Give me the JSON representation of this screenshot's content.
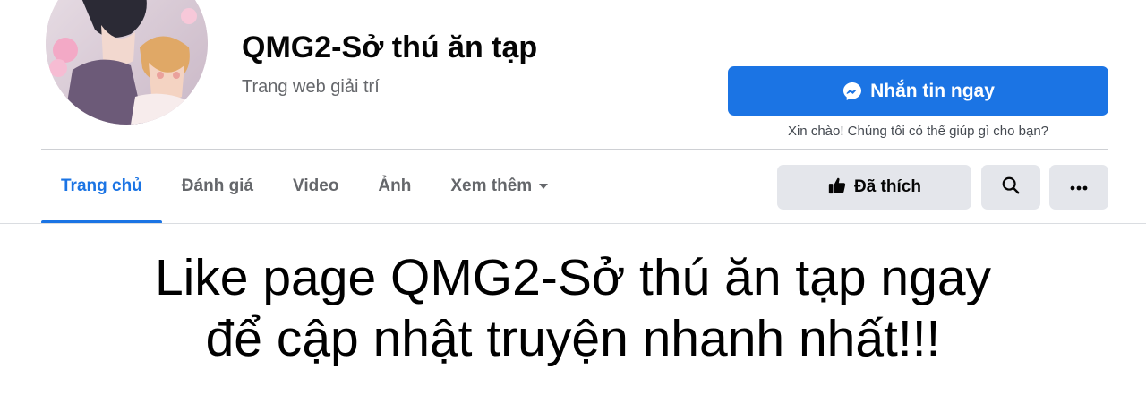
{
  "header": {
    "title": "QMG2-Sở thú ăn tạp",
    "category": "Trang web giải trí"
  },
  "message": {
    "button_label": "Nhắn tin ngay",
    "greeting": "Xin chào! Chúng tôi có thể giúp gì cho bạn?"
  },
  "tabs": [
    {
      "label": "Trang chủ",
      "active": true
    },
    {
      "label": "Đánh giá"
    },
    {
      "label": "Video"
    },
    {
      "label": "Ảnh"
    },
    {
      "label": "Xem thêm"
    }
  ],
  "actions": {
    "like_label": "Đã thích",
    "search_icon": "search-icon",
    "more_icon": "more-icon"
  },
  "banner": {
    "line1": "Like page QMG2-Sở thú ăn tạp ngay",
    "line2": "để cập nhật truyện nhanh nhất!!!"
  },
  "colors": {
    "accent": "#1b74e4",
    "button_gray": "#e4e6eb",
    "secondary_text": "#65676b"
  }
}
